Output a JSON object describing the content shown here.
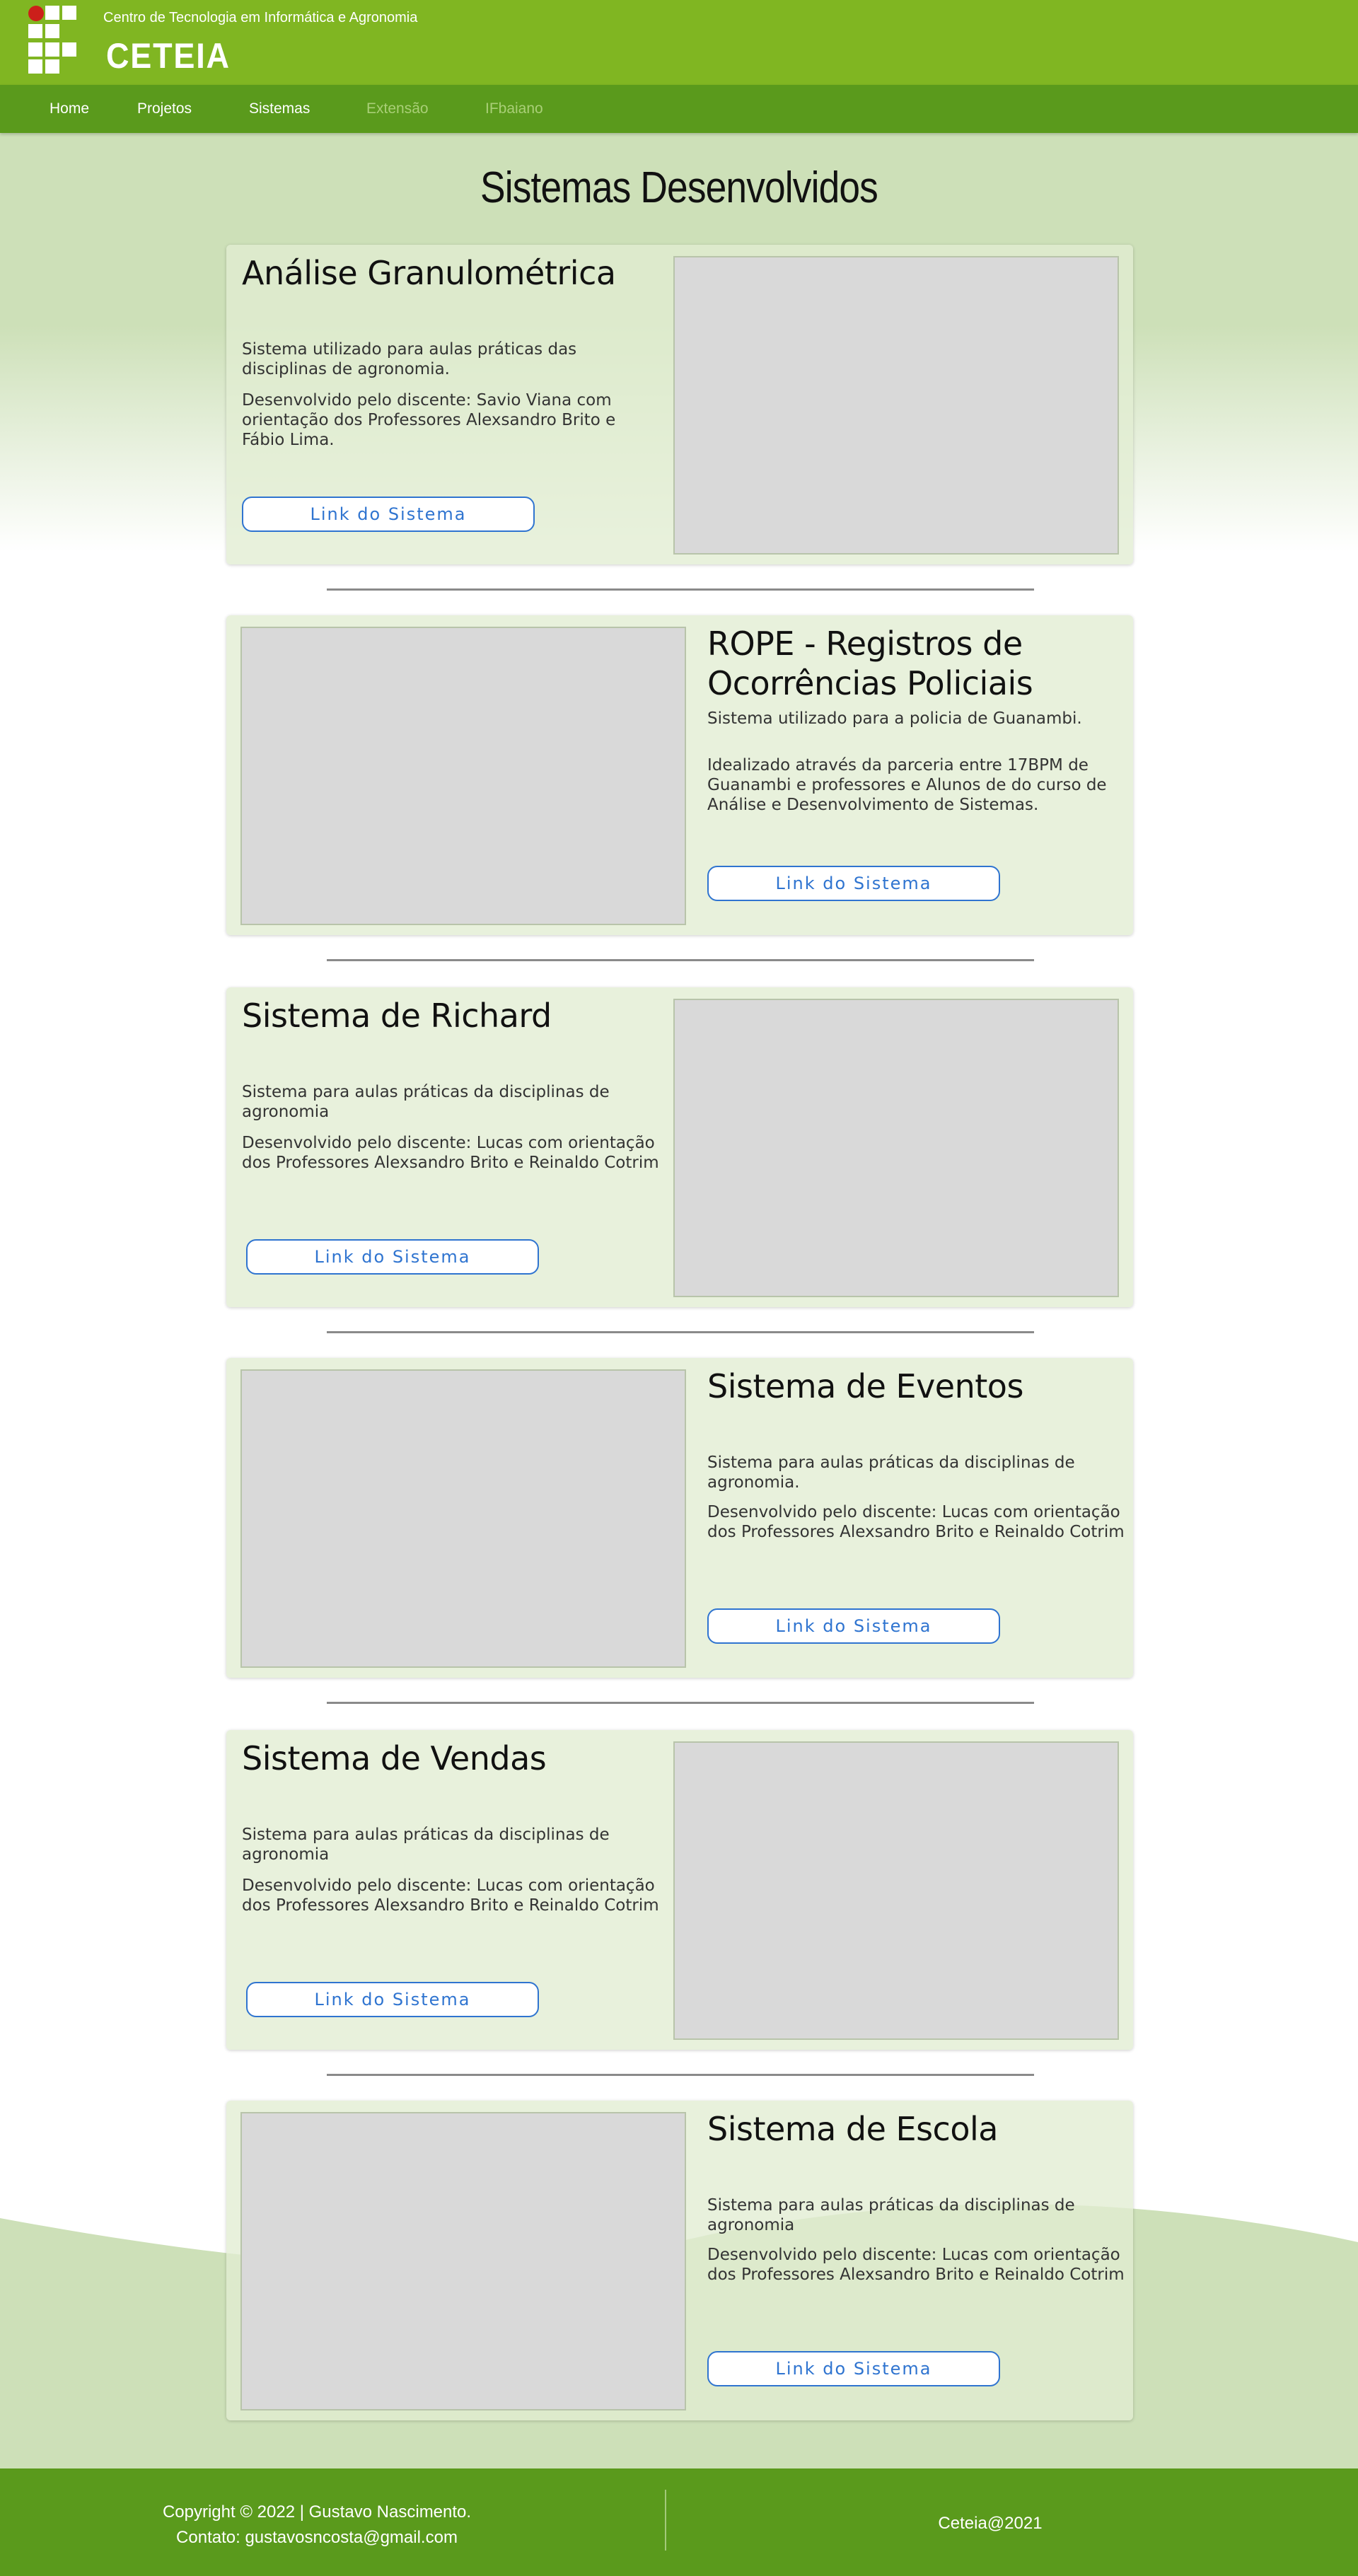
{
  "header": {
    "institution": "Centro de Tecnologia em Informática e Agronomia",
    "brand": "CETEIA",
    "logo_icon": "ifbaiano-logo-icon"
  },
  "nav": {
    "items": [
      {
        "label": "Home",
        "dim": false
      },
      {
        "label": "Projetos",
        "dim": false
      },
      {
        "label": "Sistemas",
        "dim": false
      },
      {
        "label": "Extensão",
        "dim": true
      },
      {
        "label": "IFbaiano",
        "dim": true
      }
    ]
  },
  "page_title": "Sistemas Desenvolvidos",
  "cards": [
    {
      "title": "Análise Granulométrica",
      "p1": "Sistema utilizado para aulas práticas das disciplinas de agronomia.",
      "p2": "Desenvolvido pelo discente: Savio Viana com orientação dos Professores Alexsandro Brito e Fábio Lima.",
      "button": "Link do Sistema"
    },
    {
      "title": "ROPE - Registros de Ocorrências Policiais",
      "p1": "Sistema utilizado para a policia de Guanambi.",
      "p2": "Idealizado através da parceria entre 17BPM de Guanambi e professores e Alunos de do curso de Análise e Desenvolvimento de Sistemas.",
      "button": "Link do Sistema"
    },
    {
      "title": "Sistema de Richard",
      "p1": "Sistema para aulas práticas da disciplinas de agronomia",
      "p2": "Desenvolvido pelo discente: Lucas com orientação dos Professores Alexsandro Brito e Reinaldo Cotrim",
      "button": "Link do Sistema"
    },
    {
      "title": "Sistema de Eventos",
      "p1": "Sistema para aulas práticas da disciplinas de agronomia.",
      "p2": "Desenvolvido pelo discente: Lucas com orientação dos Professores Alexsandro Brito e Reinaldo Cotrim",
      "button": "Link do Sistema"
    },
    {
      "title": "Sistema de Vendas",
      "p1": "Sistema para aulas práticas da disciplinas de agronomia",
      "p2": "Desenvolvido pelo discente: Lucas com orientação dos Professores Alexsandro Brito e Reinaldo Cotrim",
      "button": "Link do Sistema"
    },
    {
      "title": "Sistema de Escola",
      "p1": "Sistema para aulas práticas da disciplinas de agronomia",
      "p2": "Desenvolvido pelo discente: Lucas com orientação dos Professores Alexsandro Brito e Reinaldo Cotrim",
      "button": "Link do Sistema"
    }
  ],
  "footer": {
    "copyright": "Copyright © 2022 | Gustavo Nascimento.",
    "contact": "Contato: gustavosncosta@gmail.com",
    "right": "Ceteia@2021"
  },
  "colors": {
    "header": "#80b622",
    "nav": "#5a9a1c",
    "footer": "#5a9a1c",
    "page_bg": "#cde0b8",
    "button_accent": "#2f74d0"
  }
}
